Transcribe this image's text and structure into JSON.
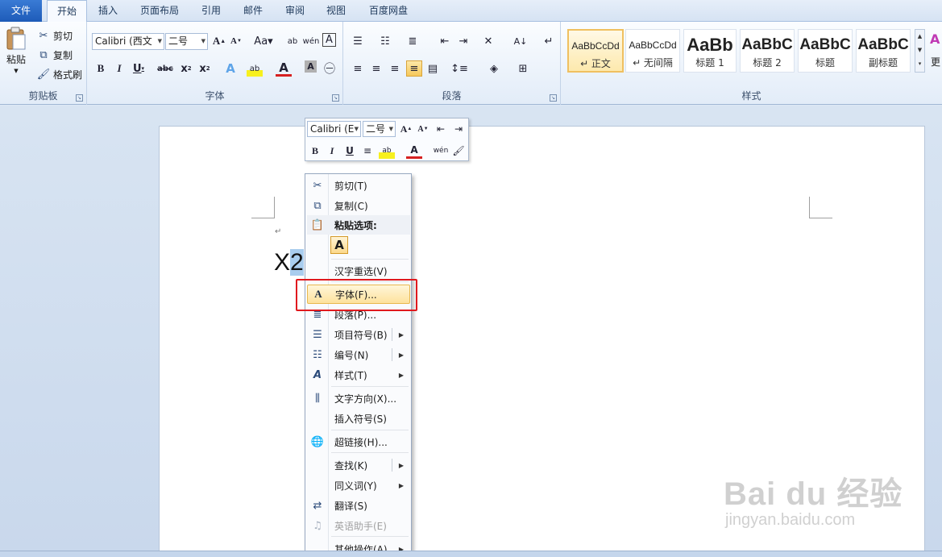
{
  "tabs": [
    "文件",
    "开始",
    "插入",
    "页面布局",
    "引用",
    "邮件",
    "审阅",
    "视图",
    "百度网盘"
  ],
  "clipboard": {
    "paste_label": "粘贴",
    "cut_label": "剪切",
    "copy_label": "复制",
    "format_painter_label": "格式刷",
    "group_label": "剪贴板"
  },
  "font": {
    "font_name": "Calibri (西文",
    "font_size": "二号",
    "group_label": "字体"
  },
  "paragraph": {
    "group_label": "段落"
  },
  "styles": {
    "group_label": "样式",
    "items": [
      {
        "sample": "AaBbCcDd",
        "name": "↵ 正文"
      },
      {
        "sample": "AaBbCcDd",
        "name": "↵ 无间隔"
      },
      {
        "sample": "AaBb",
        "name": "标题 1"
      },
      {
        "sample": "AaBbC",
        "name": "标题 2"
      },
      {
        "sample": "AaBbC",
        "name": "标题"
      },
      {
        "sample": "AaBbC",
        "name": "副标题"
      }
    ],
    "more_label": "更"
  },
  "document": {
    "para_mark": "↵",
    "text_plain": "X",
    "text_selected": "2"
  },
  "mini_toolbar": {
    "font_name": "Calibri (E",
    "font_size": "二号"
  },
  "context_menu": {
    "items": [
      {
        "label": "剪切(T)",
        "icon": "scissors-icon"
      },
      {
        "label": "复制(C)",
        "icon": "copy-icon"
      },
      {
        "label": "粘贴选项:",
        "icon": "paste-icon"
      },
      {
        "label": "汉字重选(V)"
      },
      {
        "label": "字体(F)...",
        "icon": "font-icon"
      },
      {
        "label": "段落(P)...",
        "icon": "paragraph-icon"
      },
      {
        "label": "项目符号(B)",
        "icon": "bullets-icon"
      },
      {
        "label": "编号(N)",
        "icon": "numbering-icon"
      },
      {
        "label": "样式(T)",
        "icon": "styles-icon"
      },
      {
        "label": "文字方向(X)...",
        "icon": "text-direction-icon"
      },
      {
        "label": "插入符号(S)"
      },
      {
        "label": "超链接(H)...",
        "icon": "hyperlink-icon"
      },
      {
        "label": "查找(K)"
      },
      {
        "label": "同义词(Y)"
      },
      {
        "label": "翻译(S)",
        "icon": "translate-icon"
      },
      {
        "label": "英语助手(E)",
        "icon": "english-assistant-icon"
      },
      {
        "label": "其他操作(A)"
      }
    ],
    "paste_option_glyph": "A"
  },
  "watermark": {
    "main": "Bai du 经验",
    "sub": "jingyan.baidu.com"
  }
}
